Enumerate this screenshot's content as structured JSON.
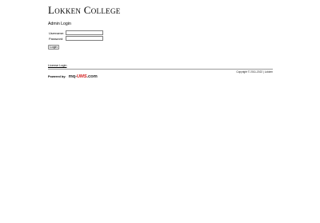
{
  "header": {
    "college_name": "Lokken College"
  },
  "login": {
    "title": "Admin Login",
    "username_label": "Username:",
    "username_value": "",
    "password_label": "Password:",
    "password_value": "",
    "submit_label": "Login"
  },
  "footer": {
    "license_link": "License Login",
    "copyright": "Copyright © 2011-2022 | Lokken",
    "powered_by_label": "Powered by:",
    "logo": {
      "part_a": "mq-",
      "part_b": "UMS",
      "part_c": ".com",
      "accent_color": "#d42020"
    }
  }
}
